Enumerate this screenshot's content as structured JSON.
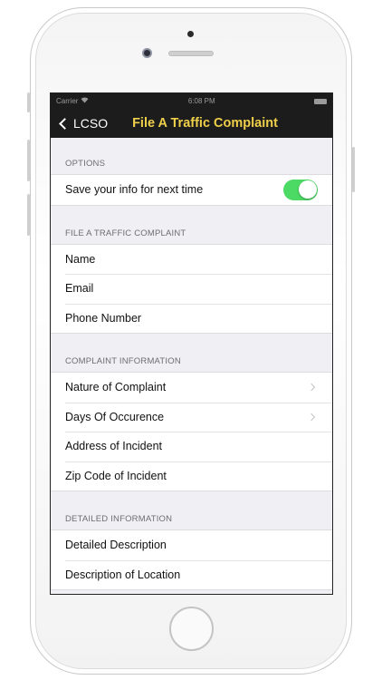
{
  "colors": {
    "nav_background": "#1c1c1c",
    "title_accent": "#f0d04a",
    "toggle_on": "#4cd964",
    "section_text": "#6d6d72",
    "screen_background": "#efeff4"
  },
  "statusbar": {
    "carrier": "Carrier",
    "time": "6:08 PM"
  },
  "navbar": {
    "back_label": "LCSO",
    "title": "File A Traffic Complaint"
  },
  "sections": {
    "options": {
      "header": "OPTIONS",
      "save_info_label": "Save your info for next time",
      "save_info_enabled": true
    },
    "file": {
      "header": "FILE A TRAFFIC COMPLAINT",
      "rows": [
        "Name",
        "Email",
        "Phone Number"
      ]
    },
    "complaint": {
      "header": "COMPLAINT INFORMATION",
      "rows": [
        "Nature of Complaint",
        "Days Of Occurence",
        "Address of Incident",
        "Zip Code of Incident"
      ]
    },
    "detailed": {
      "header": "DETAILED INFORMATION",
      "rows": [
        "Detailed Description",
        "Description of Location"
      ]
    }
  },
  "icons": {
    "back": "chevron-left-icon",
    "disclosure": "chevron-right-icon",
    "wifi": "wifi-icon",
    "battery": "battery-icon"
  }
}
